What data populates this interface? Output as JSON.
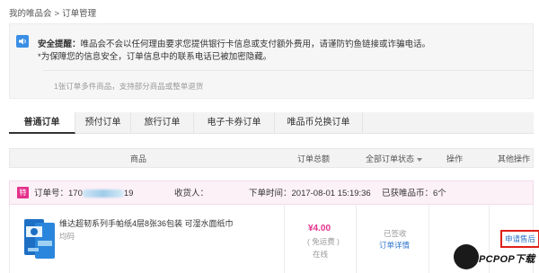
{
  "breadcrumb": {
    "home": "我的唯品会",
    "separator": ">",
    "current": "订单管理"
  },
  "notice": {
    "title": "安全提醒：",
    "line1": "唯品会不会以任何理由要求您提供银行卡信息或支付额外费用，请谨防钓鱼链接或诈骗电话。",
    "line2": "*为保障您的信息安全，订单信息中的联系电话已被加密隐藏。",
    "hint": "1张订单多件商品，支持部分商品或整单退货"
  },
  "tabs": [
    {
      "label": "普通订单",
      "active": true
    },
    {
      "label": "预付订单",
      "active": false
    },
    {
      "label": "旅行订单",
      "active": false
    },
    {
      "label": "电子卡券订单",
      "active": false
    },
    {
      "label": "唯品币兑换订单",
      "active": false
    }
  ],
  "table_header": {
    "product": "商品",
    "total": "订单总额",
    "status_filter": "全部订单状态",
    "action": "操作",
    "other_action": "其他操作"
  },
  "order": {
    "tag": "特",
    "order_no_label": "订单号：",
    "order_no_prefix": "170",
    "order_no_suffix": "19",
    "receiver_label": "收货人：",
    "order_time": "下单时间：2017-08-01 15:19:36",
    "sold_by": "已获唯品币：6个",
    "product_name": "维达超韧系列手帕纸4层8张36包装 可湿水面纸巾",
    "product_spec": "均码",
    "price": "¥4.00",
    "price_note": "( 免运费 )",
    "pay_method": "在线",
    "status": "已签收",
    "detail_link": "订单详情",
    "after_sale": "申请售后"
  },
  "watermark": "PCPOP下载",
  "colors": {
    "accent": "#e4328c",
    "link": "#2b74c9",
    "highlight_border": "#e0201a"
  }
}
